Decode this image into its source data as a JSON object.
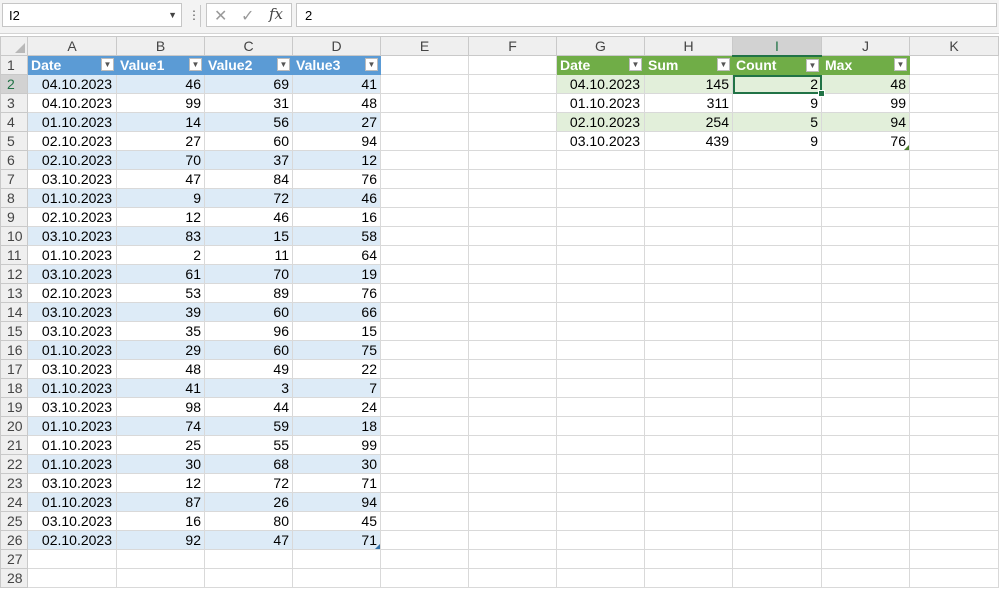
{
  "formula_bar": {
    "name_box": "I2",
    "cancel_icon": "✕",
    "enter_icon": "✓",
    "fx_label": "fx",
    "formula": "2"
  },
  "columns": [
    "A",
    "B",
    "C",
    "D",
    "E",
    "F",
    "G",
    "H",
    "I",
    "J",
    "K"
  ],
  "selected_column": "I",
  "rows": [
    "1",
    "2",
    "3",
    "4",
    "5",
    "6",
    "7",
    "8",
    "9",
    "10",
    "11",
    "12",
    "13",
    "14",
    "15",
    "16",
    "17",
    "18",
    "19",
    "20",
    "21",
    "22",
    "23",
    "24",
    "25",
    "26",
    "27",
    "28"
  ],
  "selected_row": "2",
  "table1": {
    "headers": [
      "Date",
      "Value1",
      "Value2",
      "Value3"
    ],
    "rows": [
      [
        "04.10.2023",
        "46",
        "69",
        "41"
      ],
      [
        "04.10.2023",
        "99",
        "31",
        "48"
      ],
      [
        "01.10.2023",
        "14",
        "56",
        "27"
      ],
      [
        "02.10.2023",
        "27",
        "60",
        "94"
      ],
      [
        "02.10.2023",
        "70",
        "37",
        "12"
      ],
      [
        "03.10.2023",
        "47",
        "84",
        "76"
      ],
      [
        "01.10.2023",
        "9",
        "72",
        "46"
      ],
      [
        "02.10.2023",
        "12",
        "46",
        "16"
      ],
      [
        "03.10.2023",
        "83",
        "15",
        "58"
      ],
      [
        "01.10.2023",
        "2",
        "11",
        "64"
      ],
      [
        "03.10.2023",
        "61",
        "70",
        "19"
      ],
      [
        "02.10.2023",
        "53",
        "89",
        "76"
      ],
      [
        "03.10.2023",
        "39",
        "60",
        "66"
      ],
      [
        "03.10.2023",
        "35",
        "96",
        "15"
      ],
      [
        "01.10.2023",
        "29",
        "60",
        "75"
      ],
      [
        "03.10.2023",
        "48",
        "49",
        "22"
      ],
      [
        "01.10.2023",
        "41",
        "3",
        "7"
      ],
      [
        "03.10.2023",
        "98",
        "44",
        "24"
      ],
      [
        "01.10.2023",
        "74",
        "59",
        "18"
      ],
      [
        "01.10.2023",
        "25",
        "55",
        "99"
      ],
      [
        "01.10.2023",
        "30",
        "68",
        "30"
      ],
      [
        "03.10.2023",
        "12",
        "72",
        "71"
      ],
      [
        "01.10.2023",
        "87",
        "26",
        "94"
      ],
      [
        "03.10.2023",
        "16",
        "80",
        "45"
      ],
      [
        "02.10.2023",
        "92",
        "47",
        "71"
      ]
    ]
  },
  "table2": {
    "headers": [
      "Date",
      "Sum",
      "Count",
      "Max"
    ],
    "rows": [
      [
        "04.10.2023",
        "145",
        "2",
        "48"
      ],
      [
        "01.10.2023",
        "311",
        "9",
        "99"
      ],
      [
        "02.10.2023",
        "254",
        "5",
        "94"
      ],
      [
        "03.10.2023",
        "439",
        "9",
        "76"
      ]
    ]
  },
  "colors": {
    "table1_header": "#5b9bd5",
    "table1_band": "#ddebf7",
    "table2_header": "#70ad47",
    "table2_band": "#e2efda",
    "selection": "#217346"
  }
}
